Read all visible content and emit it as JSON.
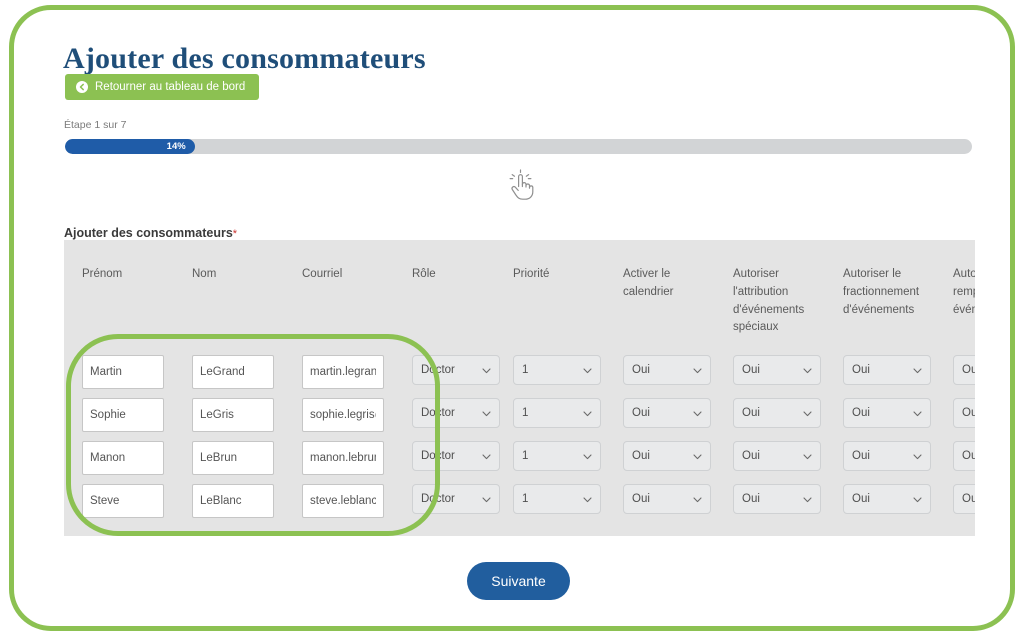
{
  "page": {
    "title": "Ajouter des consommateurs"
  },
  "back_button": {
    "label": "Retourner au tableau de bord",
    "icon": "arrow-left-circle-icon",
    "color": "#8cc152"
  },
  "progress": {
    "step_label": "Étape 1 sur 7",
    "percent_label": "14%",
    "percent_value": 14,
    "current_step": 1,
    "total_steps": 7,
    "fill_color": "#1f5ca8",
    "track_color": "#d2d4d6"
  },
  "cursor": {
    "icon": "tap-hand-gesture-icon"
  },
  "form": {
    "label": "Ajouter des consommateurs",
    "required_marker": "*",
    "required_color": "#c9302c",
    "headers": [
      "Prénom",
      "Nom",
      "Courriel",
      "Rôle",
      "Priorité",
      "Activer le calendrier",
      "Autoriser l'attribution d'événements spéciaux",
      "Autoriser le fractionnement d'événements",
      "Autoriser le remplacement par événements"
    ],
    "rows": [
      {
        "prenom": "Martin",
        "nom": "LeGrand",
        "courriel": "martin.legrand@example.com",
        "role": "Doctor",
        "priorite": "1",
        "calendrier": "Oui",
        "attribution": "Oui",
        "fractionnement": "Oui",
        "remplacement": "Oui"
      },
      {
        "prenom": "Sophie",
        "nom": "LeGris",
        "courriel": "sophie.legris@example.com",
        "role": "Doctor",
        "priorite": "1",
        "calendrier": "Oui",
        "attribution": "Oui",
        "fractionnement": "Oui",
        "remplacement": "Oui"
      },
      {
        "prenom": "Manon",
        "nom": "LeBrun",
        "courriel": "manon.lebrun@example.com",
        "role": "Doctor",
        "priorite": "1",
        "calendrier": "Oui",
        "attribution": "Oui",
        "fractionnement": "Oui",
        "remplacement": "Oui"
      },
      {
        "prenom": "Steve",
        "nom": "LeBlanc",
        "courriel": "steve.leblanc@example.com",
        "role": "Doctor",
        "priorite": "1",
        "calendrier": "Oui",
        "attribution": "Oui",
        "fractionnement": "Oui",
        "remplacement": "Oui"
      }
    ]
  },
  "next_button": {
    "label": "Suivante",
    "color": "#215e9e"
  },
  "annotations": {
    "outer_frame_color": "#8cc152",
    "highlight_color": "#8cc152"
  }
}
